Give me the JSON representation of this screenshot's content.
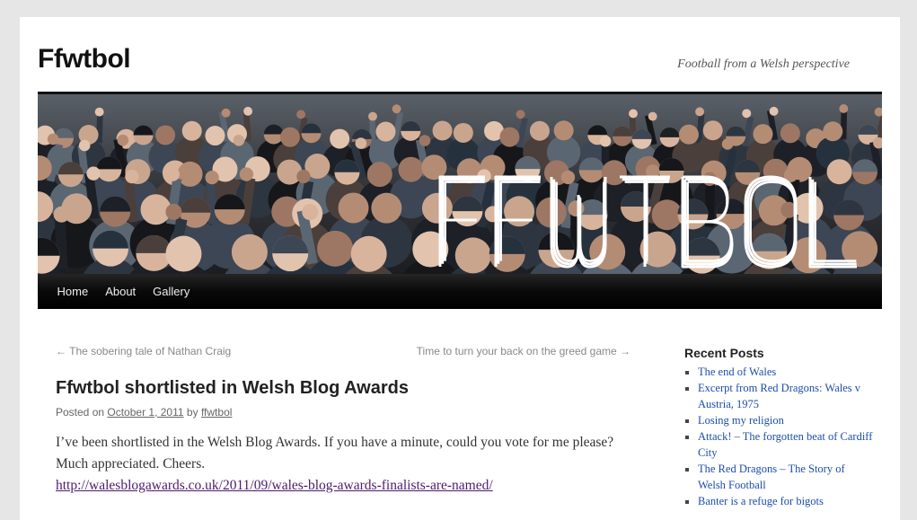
{
  "site": {
    "title": "Ffwtbol",
    "description": "Football from a Welsh perspective",
    "banner_text": "FFWTBOL"
  },
  "nav": {
    "items": [
      "Home",
      "About",
      "Gallery"
    ]
  },
  "post_nav": {
    "previous": "← The sobering tale of Nathan Craig",
    "next": "Time to turn your back on the greed game →"
  },
  "post": {
    "title": "Ffwtbol shortlisted in Welsh Blog Awards",
    "posted_on_label": "Posted on",
    "date": "October 1, 2011",
    "by_label": "by",
    "author": "ffwtbol",
    "body": "I’ve been shortlisted in the Welsh Blog Awards. If you have a minute, could you vote for me please? Much appreciated. Cheers.",
    "link": "http://walesblogawards.co.uk/2011/09/wales-blog-awards-finalists-are-named/"
  },
  "sidebar": {
    "heading": "Recent Posts",
    "items": [
      "The end of Wales",
      "Excerpt from Red Dragons: Wales v Austria, 1975",
      "Losing my religion",
      "Attack! – The forgotten beat of Cardiff City",
      "The Red Dragons – The Story of Welsh Football",
      "Banter is a refuge for bigots"
    ]
  },
  "colors": {
    "nav_background": "#000000",
    "link": "#1b4dab",
    "visited_link": "#4b1c6d",
    "page_background": "#e6e6e6"
  }
}
